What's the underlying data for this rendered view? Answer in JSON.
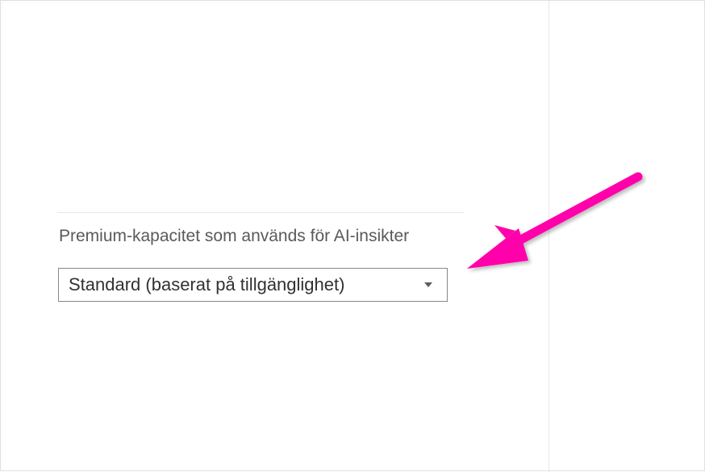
{
  "section": {
    "label": "Premium-kapacitet som används för AI-insikter"
  },
  "dropdown": {
    "value": "Standard (baserat på tillgänglighet)"
  },
  "colors": {
    "arrow": "#ff00aa"
  }
}
